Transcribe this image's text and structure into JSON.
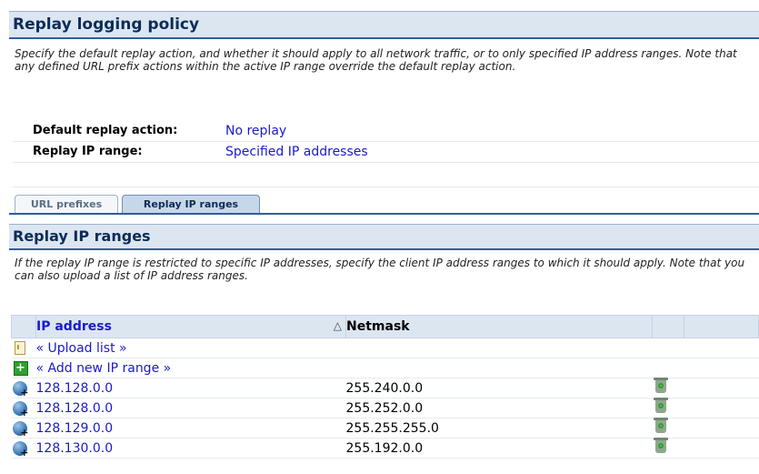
{
  "policy": {
    "title": "Replay logging policy",
    "description": "Specify the default replay action, and whether it should apply to all network traffic, or to only specified IP address ranges. Note that any defined URL prefix actions within the active IP range override the default replay action.",
    "fields": [
      {
        "label": "Default replay action:",
        "value": "No replay"
      },
      {
        "label": "Replay IP range:",
        "value": "Specified IP addresses"
      }
    ]
  },
  "tabs": [
    {
      "label": "URL prefixes",
      "active": false
    },
    {
      "label": "Replay IP ranges",
      "active": true
    }
  ],
  "ranges": {
    "title": "Replay IP ranges",
    "description": "If the replay IP range is restricted to specific IP addresses, specify the client IP address ranges to which it should apply. Note that you can also upload a list of IP address ranges.",
    "columns": {
      "ip": "IP address",
      "netmask": "Netmask",
      "sort_indicator": "△"
    },
    "actions": {
      "upload": "« Upload list »",
      "add": "« Add new IP range »"
    },
    "rows": [
      {
        "ip": "128.128.0.0",
        "netmask": "255.240.0.0"
      },
      {
        "ip": "128.128.0.0",
        "netmask": "255.252.0.0"
      },
      {
        "ip": "128.129.0.0",
        "netmask": "255.255.255.0"
      },
      {
        "ip": "128.130.0.0",
        "netmask": "255.192.0.0"
      }
    ]
  },
  "icons": {
    "upload": "upload-file-icon",
    "add": "add-icon",
    "row": "network-ip-icon",
    "delete": "trash-icon"
  },
  "colors": {
    "header_bg": "#dce6f1",
    "header_border": "#2f5f9a",
    "link": "#1a1acc",
    "title_text": "#0c2c57"
  }
}
